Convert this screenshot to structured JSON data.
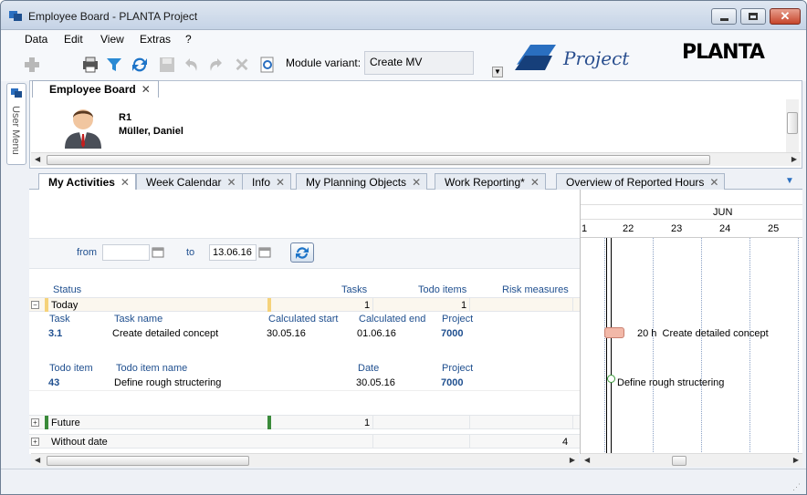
{
  "window": {
    "title": "Employee Board - PLANTA Project"
  },
  "menu": [
    "Data",
    "Edit",
    "View",
    "Extras",
    "?"
  ],
  "toolbar": {
    "module_variant_label": "Module variant:",
    "module_variant_value": "Create MV"
  },
  "logo": {
    "project_text": "Project",
    "planta_text": "PLANTA"
  },
  "user_menu": {
    "label": "User Menu"
  },
  "top_tab": {
    "label": "Employee Board"
  },
  "resource": {
    "code": "R1",
    "name": "Müller, Daniel"
  },
  "tabs": [
    {
      "label": "My Activities",
      "active": true
    },
    {
      "label": "Week Calendar"
    },
    {
      "label": "Info"
    },
    {
      "label": "My Planning Objects"
    },
    {
      "label": "Work Reporting*"
    },
    {
      "label": "Overview of Reported Hours"
    }
  ],
  "filter": {
    "from_label": "from",
    "from_value": "",
    "to_label": "to",
    "to_value": "13.06.16"
  },
  "group_header": {
    "status": "Status",
    "tasks": "Tasks",
    "todo_items": "Todo items",
    "risk_measures": "Risk measures"
  },
  "groups": {
    "today": {
      "label": "Today",
      "tasks": "1",
      "todo_items": "1"
    },
    "future": {
      "label": "Future",
      "tasks": "1"
    },
    "without_date": {
      "label": "Without date",
      "risk_measures": "4"
    }
  },
  "task_table": {
    "headers": {
      "task": "Task",
      "task_name": "Task name",
      "calc_start": "Calculated start",
      "calc_end": "Calculated end",
      "project": "Project"
    },
    "row": {
      "task": "3.1",
      "task_name": "Create detailed concept",
      "calc_start": "30.05.16",
      "calc_end": "01.06.16",
      "project": "7000"
    }
  },
  "todo_table": {
    "headers": {
      "todo_item": "Todo item",
      "todo_item_name": "Todo item name",
      "date": "Date",
      "project": "Project"
    },
    "row": {
      "todo_item": "43",
      "todo_item_name": "Define rough structering",
      "date": "30.05.16",
      "project": "7000"
    }
  },
  "gantt": {
    "month": "JUN",
    "days": [
      "1",
      "22",
      "23",
      "24",
      "25"
    ],
    "bar_text": "20 h  Create detailed concept",
    "milestone_text": "Define rough structering",
    "colors": {
      "bar": "#f2b8a8",
      "milestone": "#3a9a3a",
      "today_line": "#000000"
    }
  },
  "colors": {
    "today_marker": "#f5d27a",
    "future_marker": "#3a8a3a",
    "link_blue": "#1f4f8f"
  }
}
